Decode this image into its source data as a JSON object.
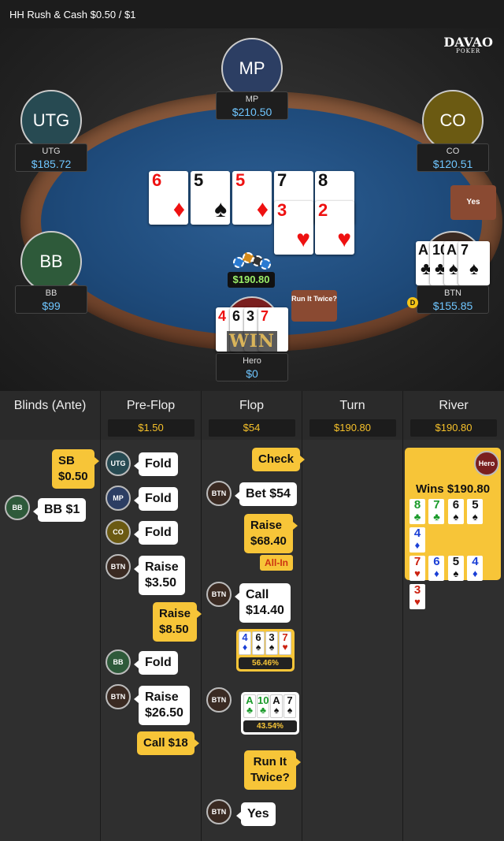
{
  "header": {
    "title": "HH  Rush & Cash $0.50 / $1"
  },
  "logo": {
    "brand": "DAVAO",
    "sub": "POKER"
  },
  "seats": {
    "mp": {
      "label": "MP",
      "name": "MP",
      "stack": "$210.50",
      "color": "#2c3e63"
    },
    "utg": {
      "label": "UTG",
      "name": "UTG",
      "stack": "$185.72",
      "color": "#274a52"
    },
    "co": {
      "label": "CO",
      "name": "CO",
      "stack": "$120.51",
      "color": "#6b5a12"
    },
    "bb": {
      "label": "BB",
      "name": "BB",
      "stack": "$99",
      "color": "#2e5a3a"
    },
    "btn": {
      "name": "BTN",
      "stack": "$155.85"
    },
    "hero": {
      "name": "Hero",
      "stack": "$0"
    }
  },
  "board": [
    {
      "rank": "6",
      "suit": "♦",
      "red": true
    },
    {
      "rank": "5",
      "suit": "♠",
      "red": false
    },
    {
      "rank": "5",
      "suit": "♦",
      "red": true
    },
    {
      "rank": "7",
      "suit": "♣",
      "red": false
    },
    {
      "rank": "8",
      "suit": "♣",
      "red": false
    },
    {
      "rank": "3",
      "suit": "♥",
      "red": true
    },
    {
      "rank": "2",
      "suit": "♥",
      "red": true
    }
  ],
  "pot": "$190.80",
  "dealer": "D",
  "yes_bubble": "Yes",
  "run_it_twice_bubble": "Run It Twice?",
  "win_label": "WIN",
  "hero_cards": [
    {
      "rank": "4",
      "red": true
    },
    {
      "rank": "6",
      "red": false
    },
    {
      "rank": "3",
      "red": false
    },
    {
      "rank": "7",
      "red": true
    }
  ],
  "btn_cards": [
    {
      "rank": "A",
      "suit": "♣"
    },
    {
      "rank": "10",
      "suit": "♣"
    },
    {
      "rank": "A",
      "suit": "♠"
    },
    {
      "rank": "7",
      "suit": "♠"
    }
  ],
  "history": {
    "columns": [
      {
        "title": "Blinds (Ante)",
        "pot": ""
      },
      {
        "title": "Pre-Flop",
        "pot": "$1.50"
      },
      {
        "title": "Flop",
        "pot": "$54"
      },
      {
        "title": "Turn",
        "pot": "$190.80"
      },
      {
        "title": "River",
        "pot": "$190.80"
      }
    ],
    "blinds": {
      "sb": "SB\n$0.50",
      "bb_pill": "BB",
      "bb": "BB  $1"
    },
    "preflop": {
      "utg": "UTG",
      "utg_act": "Fold",
      "mp": "MP",
      "mp_act": "Fold",
      "co": "CO",
      "co_act": "Fold",
      "btn": "BTN",
      "btn_act": "Raise\n$3.50",
      "hero_raise": "Raise\n$8.50",
      "bb": "BB",
      "bb_act": "Fold",
      "btn2": "BTN",
      "btn_act2": "Raise\n$26.50",
      "hero_call": "Call  $18"
    },
    "flop": {
      "hero_check": "Check",
      "btn": "BTN",
      "btn_bet": "Bet  $54",
      "hero_raise": "Raise\n$68.40",
      "allin": "All-In",
      "btn2": "BTN",
      "btn_call": "Call\n$14.40",
      "hero_eq": "56.46%",
      "btn3": "BTN",
      "btn_eq": "43.54%",
      "rit": "Run It\nTwice?",
      "btn4": "BTN",
      "yes": "Yes"
    },
    "river": {
      "hero": "Hero",
      "wins": "Wins $190.80"
    }
  }
}
